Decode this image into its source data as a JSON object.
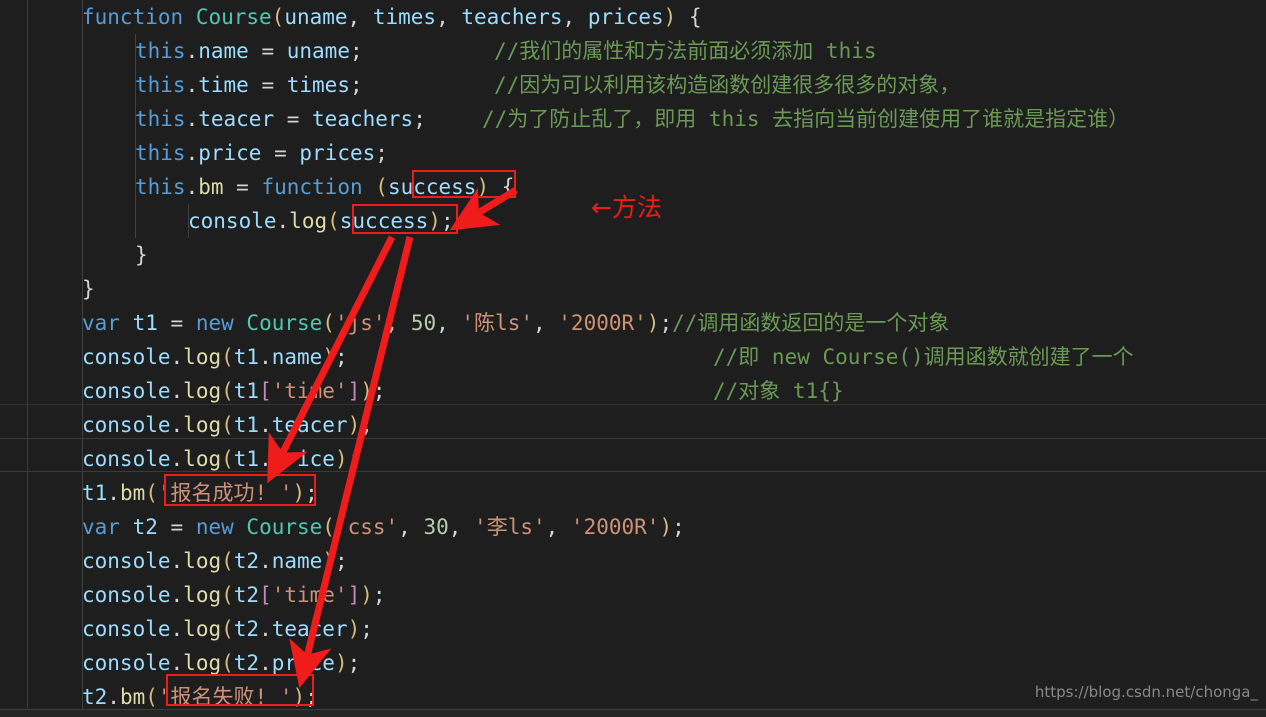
{
  "app": {
    "type": "code-editor-screenshot",
    "theme": "dark-plus",
    "language": "javascript"
  },
  "colors": {
    "background": "#1e1e1e",
    "keyword": "#569cd6",
    "function_name": "#4ec9b0",
    "variable": "#9cdcfe",
    "method": "#dcdcaa",
    "string": "#ce9178",
    "number": "#b5cea8",
    "comment": "#6a9955",
    "punctuation": "#d4d4d4",
    "annotation_red": "#f01c1c",
    "watermark_gray": "#9b9b9b"
  },
  "editor": {
    "lines": [
      {
        "id": 1,
        "text": "function Course(uname, times, teachers, prices) {"
      },
      {
        "id": 2,
        "text": "    this.name = uname;              //我们的属性和方法前面必须添加 this"
      },
      {
        "id": 3,
        "text": "    this.time = times;              //因为可以利用该构造函数创建很多很多的对象,"
      },
      {
        "id": 4,
        "text": "    this.teacer = teachers;   //为了防止乱了，即用 this 去指向当前创建使用了谁就是指定谁）"
      },
      {
        "id": 5,
        "text": "    this.price = prices;"
      },
      {
        "id": 6,
        "text": "    this.bm = function (success) {"
      },
      {
        "id": 7,
        "text": "        console.log(success);"
      },
      {
        "id": 8,
        "text": "    }"
      },
      {
        "id": 9,
        "text": "}"
      },
      {
        "id": 10,
        "text": "var t1 = new Course('js', 50, '陈ls', '2000R');//调用函数返回的是一个对象"
      },
      {
        "id": 11,
        "text": "console.log(t1.name);                         //即 new Course()调用函数就创建了一个"
      },
      {
        "id": 12,
        "text": "console.log(t1['time']);                      //对象 t1{}"
      },
      {
        "id": 13,
        "text": "console.log(t1.teacer);"
      },
      {
        "id": 14,
        "text": "console.log(t1.price);"
      },
      {
        "id": 15,
        "text": "t1.bm('报名成功! ');"
      },
      {
        "id": 16,
        "text": "var t2 = new Course('css', 30, '李ls', '2000R');"
      },
      {
        "id": 17,
        "text": "console.log(t2.name);"
      },
      {
        "id": 18,
        "text": "console.log(t2['time']);"
      },
      {
        "id": 19,
        "text": "console.log(t2.teacer);"
      },
      {
        "id": 20,
        "text": "console.log(t2.price);"
      },
      {
        "id": 21,
        "text": "t2.bm('报名失败! ');"
      }
    ],
    "tokens": {
      "kw_function": "function",
      "kw_var": "var",
      "kw_new": "new",
      "name_course": "Course",
      "param_uname": "uname",
      "param_times": "times",
      "param_teachers": "teachers",
      "param_prices": "prices",
      "kw_this": "this",
      "prop_name": "name",
      "prop_time": "time",
      "prop_teacer": "teacer",
      "prop_price": "price",
      "prop_bm": "bm",
      "param_success": "success",
      "obj_console": "console",
      "meth_log": "log",
      "var_t1": "t1",
      "var_t2": "t2",
      "str_js": "'js'",
      "str_css": "'css'",
      "num_50": "50",
      "num_30": "30",
      "str_chen": "'陈ls'",
      "str_li": "'李ls'",
      "str_price": "'2000R'",
      "str_time_key": "'time'",
      "str_success_msg": "'报名成功! '",
      "str_fail_msg": "'报名失败! '"
    },
    "comments": {
      "c1": "//我们的属性和方法前面必须添加 this",
      "c2": "//因为可以利用该构造函数创建很多很多的对象，",
      "c3": "//为了防止乱了，即用 this 去指向当前创建使用了谁就是指定谁）",
      "c4": "//调用函数返回的是一个对象",
      "c5": "//即 new Course()调用函数就创建了一个",
      "c6": "//对象 t1{}"
    }
  },
  "annotations": {
    "label_method": "←方法",
    "boxes": [
      {
        "name": "box-param-success",
        "target": "success (function parameter)"
      },
      {
        "name": "box-arg-success",
        "target": "success (console.log argument)"
      },
      {
        "name": "box-string-success-msg",
        "target": "'报名成功! '"
      },
      {
        "name": "box-string-fail-msg",
        "target": "'报名失败! '"
      }
    ],
    "arrows": [
      {
        "name": "arrow-param-to-log",
        "from": "success (parameter)",
        "to": "success (console.log argument)"
      },
      {
        "name": "arrow-log-to-t1-msg",
        "from": "console.log(success)",
        "to": "'报名成功! '"
      },
      {
        "name": "arrow-log-to-t2-msg",
        "from": "console.log(success)",
        "to": "'报名失败! '"
      }
    ]
  },
  "watermark": {
    "url": "https://blog.csdn.net/chonga_"
  }
}
